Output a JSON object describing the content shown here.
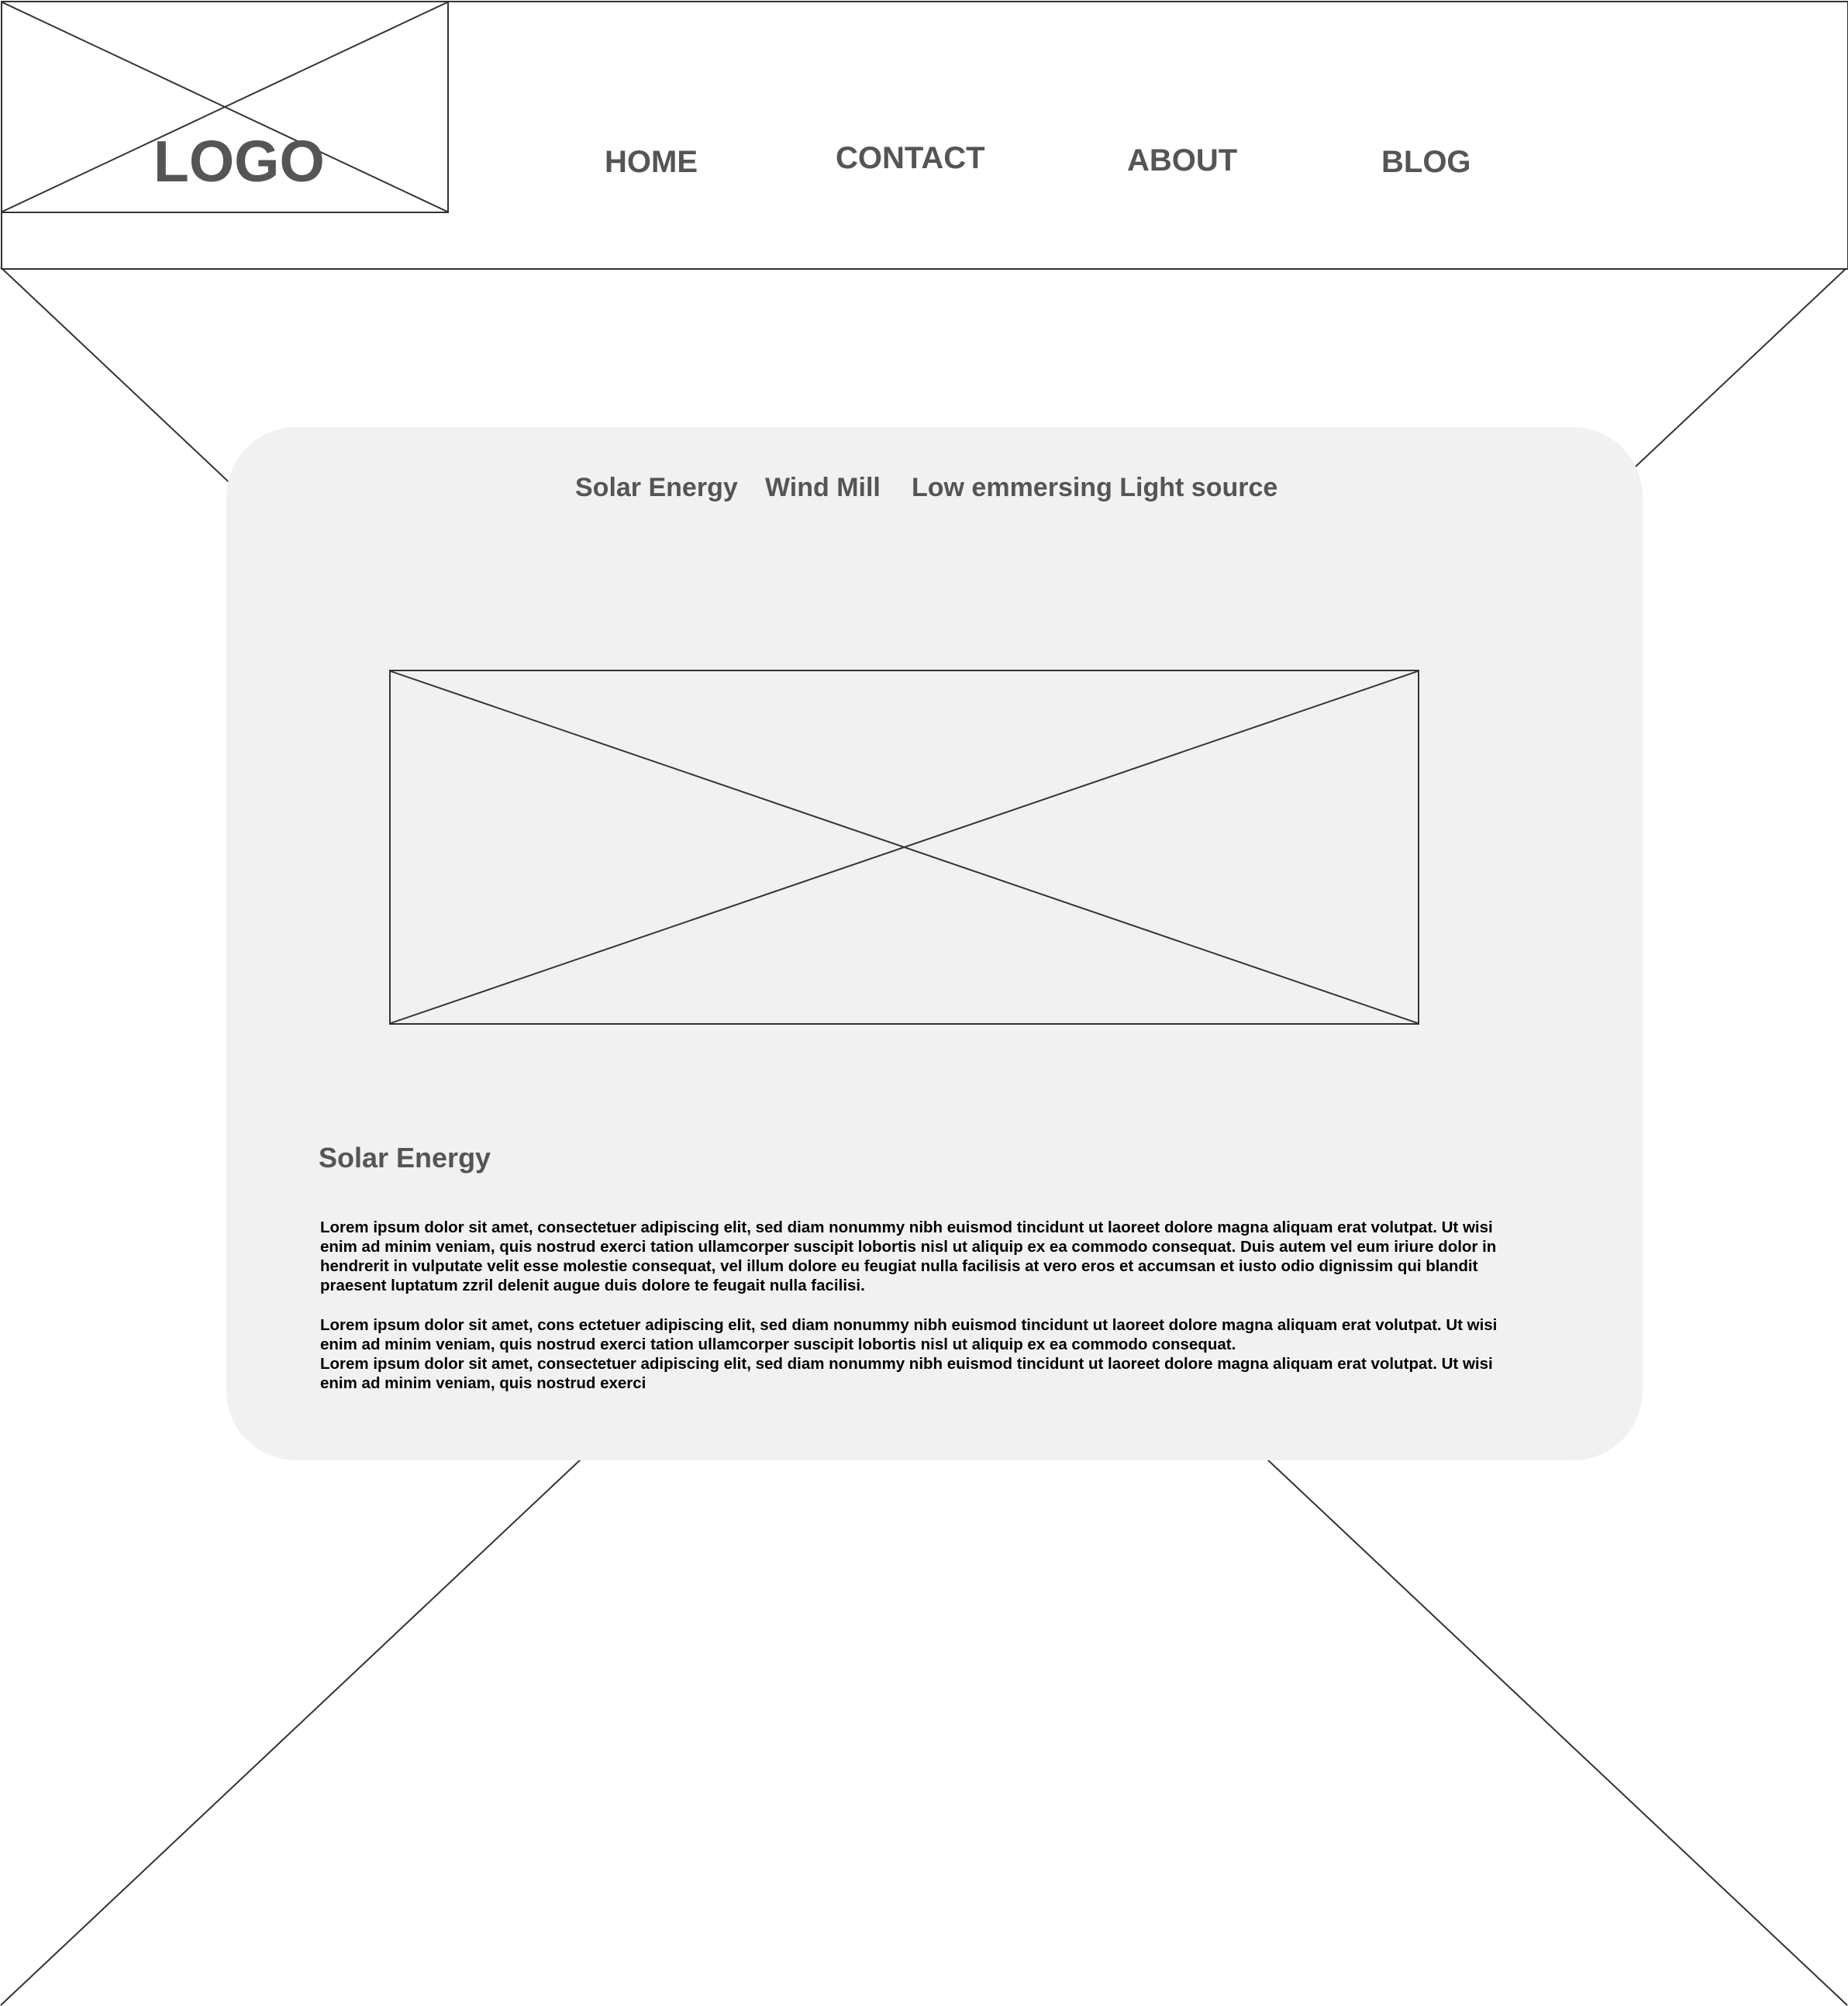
{
  "header": {
    "logo_text": "LOGO",
    "nav": {
      "home": "HOME",
      "contact": "CONTACT",
      "about": "ABOUT",
      "blog": "BLOG"
    }
  },
  "card": {
    "tabs": {
      "solar": "Solar Energy",
      "wind": "Wind Mill",
      "light": "Low emmersing Light source"
    },
    "section_title": "Solar Energy",
    "paragraph_1": "Lorem ipsum dolor sit amet, consectetuer adipiscing elit, sed diam nonummy nibh euismod tincidunt ut laoreet dolore magna aliquam erat volutpat. Ut wisi enim ad minim veniam, quis nostrud exerci tation ullamcorper suscipit lobortis nisl ut aliquip ex ea commodo consequat. Duis autem vel eum iriure dolor in hendrerit in vulputate velit esse molestie consequat, vel illum dolore eu feugiat nulla facilisis at vero eros et accumsan et iusto odio dignissim qui blandit praesent luptatum zzril delenit augue duis dolore te feugait nulla facilisi.",
    "paragraph_2": "Lorem ipsum dolor sit amet, cons ectetuer adipiscing elit, sed diam nonummy nibh euismod tincidunt ut laoreet dolore magna aliquam erat volutpat. Ut wisi enim ad minim veniam, quis nostrud exerci tation ullamcorper suscipit lobortis nisl ut aliquip ex ea commodo consequat.\nLorem ipsum dolor sit amet, consectetuer adipiscing elit, sed diam nonummy nibh euismod tincidunt ut laoreet dolore magna aliquam erat volutpat. Ut wisi enim ad minim veniam, quis nostrud exerci"
  },
  "colors": {
    "stroke": "#333333",
    "label_gray": "#555555",
    "card_background": "#f1f1f1",
    "page_background": "#ffffff"
  }
}
